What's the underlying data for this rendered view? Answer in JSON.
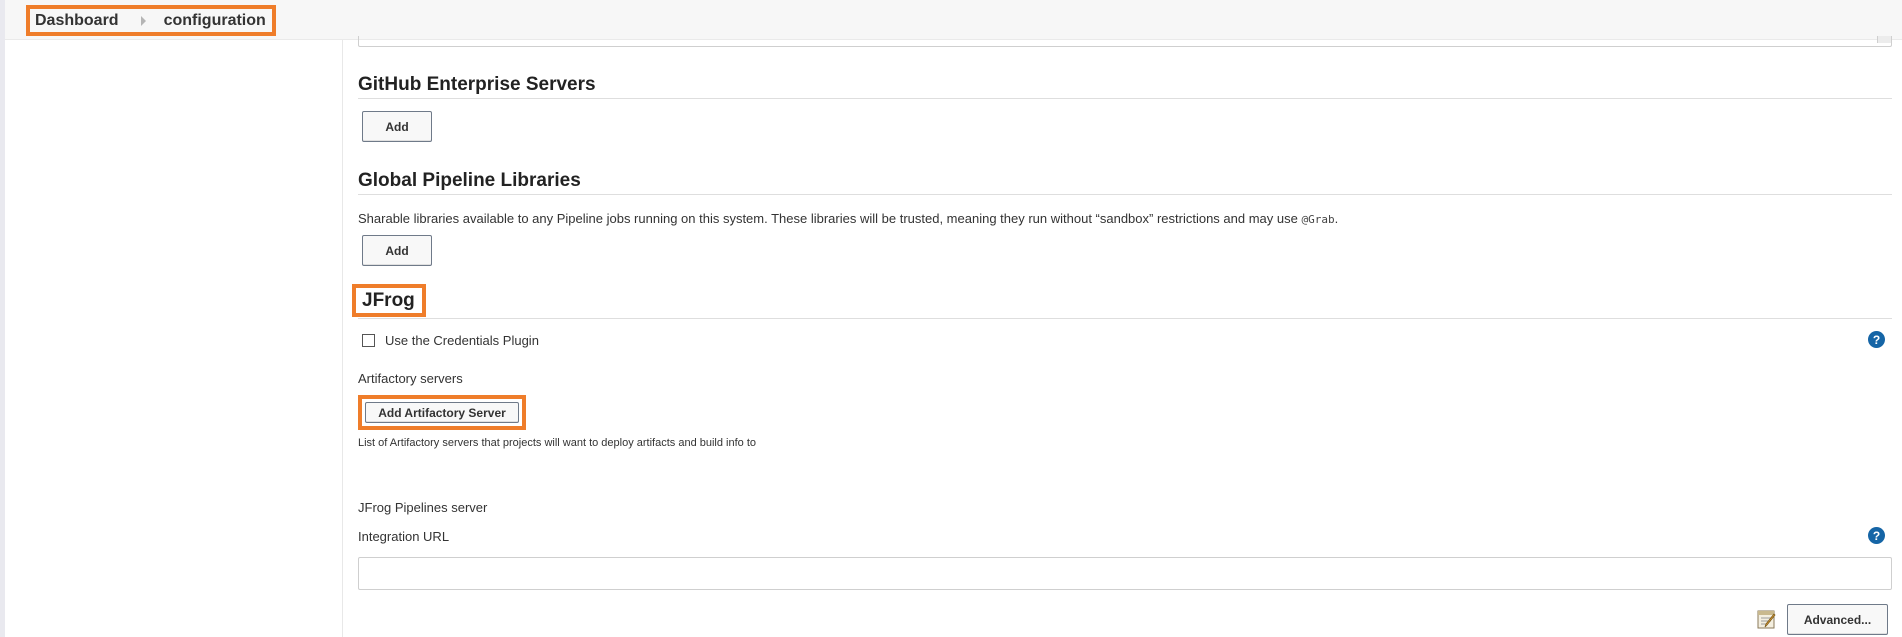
{
  "breadcrumb": {
    "items": [
      "Dashboard",
      "configuration"
    ]
  },
  "sections": {
    "github_enterprise": {
      "title": "GitHub Enterprise Servers",
      "add_label": "Add"
    },
    "global_pipeline_libraries": {
      "title": "Global Pipeline Libraries",
      "description_before": "Sharable libraries available to any Pipeline jobs running on this system. These libraries will be trusted, meaning they run without “sandbox” restrictions and may use ",
      "description_code": "@Grab",
      "description_after": ".",
      "add_label": "Add"
    },
    "jfrog": {
      "title": "JFrog",
      "credentials_plugin_label": "Use the Credentials Plugin",
      "credentials_plugin_checked": false,
      "artifactory_servers_label": "Artifactory servers",
      "add_artifactory_label": "Add Artifactory Server",
      "artifactory_description": "List of Artifactory servers that projects will want to deploy artifacts and build info to",
      "pipelines_server_label": "JFrog Pipelines server",
      "integration_url_label": "Integration URL",
      "integration_url_value": "",
      "advanced_label": "Advanced..."
    }
  },
  "icons": {
    "help": "help-icon",
    "notepad": "notepad-icon",
    "breadcrumb_separator": "chevron-right-icon"
  },
  "colors": {
    "highlight": "#ef7d2a",
    "help_blue": "#1565a6"
  }
}
